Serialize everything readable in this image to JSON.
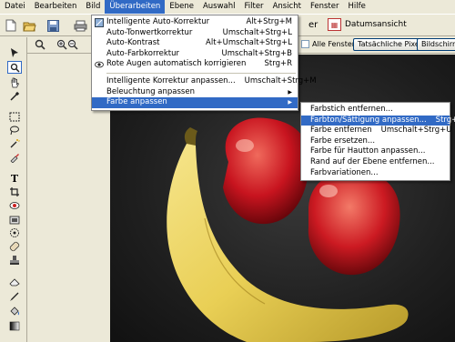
{
  "menubar": [
    "Datei",
    "Bearbeiten",
    "Bild",
    "Überarbeiten",
    "Ebene",
    "Auswahl",
    "Filter",
    "Ansicht",
    "Fenster",
    "Hilfe"
  ],
  "menubar_active": "Überarbeiten",
  "toolbar": {
    "partial_label": "er",
    "datum_label": "Datumsansicht"
  },
  "options": {
    "all_windows": "Alle Fenster",
    "actual_pixels": "Tatsächliche Pixel",
    "screen_fit": "Bildschirmg"
  },
  "menu_main": {
    "items": [
      {
        "label": "Intelligente Auto-Korrektur",
        "shortcut": "Alt+Strg+M",
        "icon": "auto-fix-icon"
      },
      {
        "label": "Auto-Tonwertkorrektur",
        "shortcut": "Umschalt+Strg+L"
      },
      {
        "label": "Auto-Kontrast",
        "shortcut": "Alt+Umschalt+Strg+L"
      },
      {
        "label": "Auto-Farbkorrektur",
        "shortcut": "Umschalt+Strg+B"
      },
      {
        "label": "Rote Augen automatisch korrigieren",
        "shortcut": "Strg+R",
        "icon": "eye-icon"
      },
      {
        "label": "Intelligente Korrektur anpassen...",
        "shortcut": "Umschalt+Strg+M"
      },
      {
        "label": "Beleuchtung anpassen",
        "shortcut": "",
        "submenu": true
      },
      {
        "label": "Farbe anpassen",
        "shortcut": "",
        "submenu": true,
        "highlighted": true
      }
    ]
  },
  "menu_sub": {
    "items": [
      {
        "label": "Farbstich entfernen...",
        "shortcut": ""
      },
      {
        "label": "Farbton/Sättigung anpassen...",
        "shortcut": "Strg+U",
        "highlighted": true
      },
      {
        "label": "Farbe entfernen",
        "shortcut": "Umschalt+Strg+U"
      },
      {
        "label": "Farbe ersetzen...",
        "shortcut": ""
      },
      {
        "label": "Farbe für Hautton anpassen...",
        "shortcut": ""
      },
      {
        "label": "Rand auf der Ebene entfernen...",
        "shortcut": ""
      },
      {
        "label": "Farbvariationen...",
        "shortcut": ""
      }
    ]
  },
  "colors": {
    "highlight": "#316ac5",
    "chrome": "#ece9d8",
    "canvas": "#1f1f1f"
  }
}
